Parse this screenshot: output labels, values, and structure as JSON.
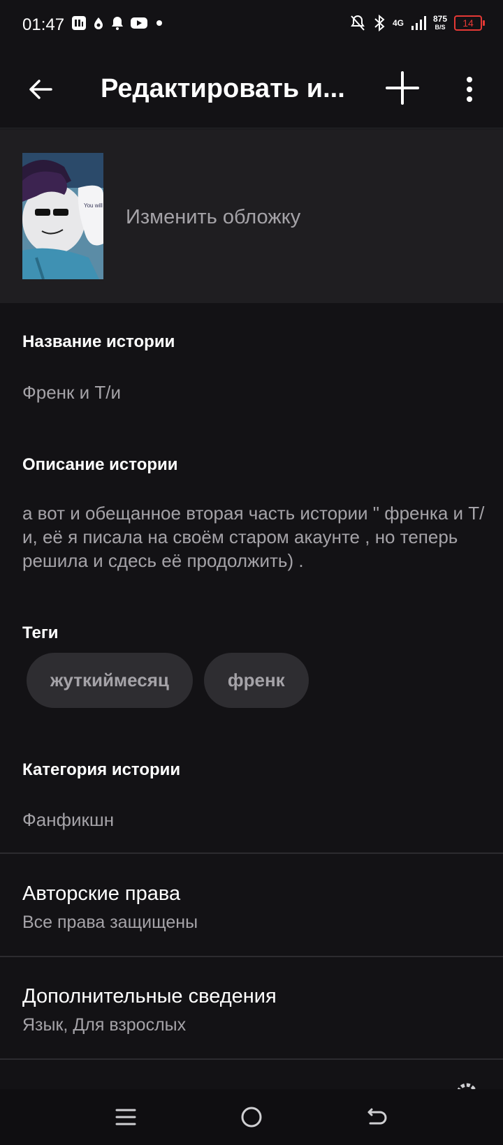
{
  "status_bar": {
    "time": "01:47",
    "network": "4G",
    "speed_value": "875",
    "speed_unit": "B/S",
    "battery": "14",
    "battery_color": "#e53935"
  },
  "app_bar": {
    "title": "Редактировать и..."
  },
  "cover": {
    "change_label": "Изменить обложку",
    "thumb_text": "You will pretty cool it babe"
  },
  "story_title": {
    "label": "Название истории",
    "value": "Френк и Т/и"
  },
  "story_description": {
    "label": "Описание истории",
    "value": "а вот и обещанное вторая часть истории \" френка и Т/и,  её я писала на своём старом акаунте  , но теперь решила и сдесь её продолжить) ."
  },
  "tags": {
    "label": "Теги",
    "items": [
      "жуткиймесяц",
      "френк"
    ]
  },
  "category": {
    "label": "Категория истории",
    "value": "Фанфикшн"
  },
  "copyright": {
    "title": "Авторские права",
    "value": "Все права защищены"
  },
  "extra_info": {
    "title": "Дополнительные сведения",
    "value": "Язык, Для взрослых"
  },
  "icons": {
    "back": "arrow-left-icon",
    "add": "plus-icon",
    "more": "more-vertical-icon",
    "nav_menu": "menu-icon",
    "nav_home": "home-circle-icon",
    "nav_back": "back-icon"
  }
}
